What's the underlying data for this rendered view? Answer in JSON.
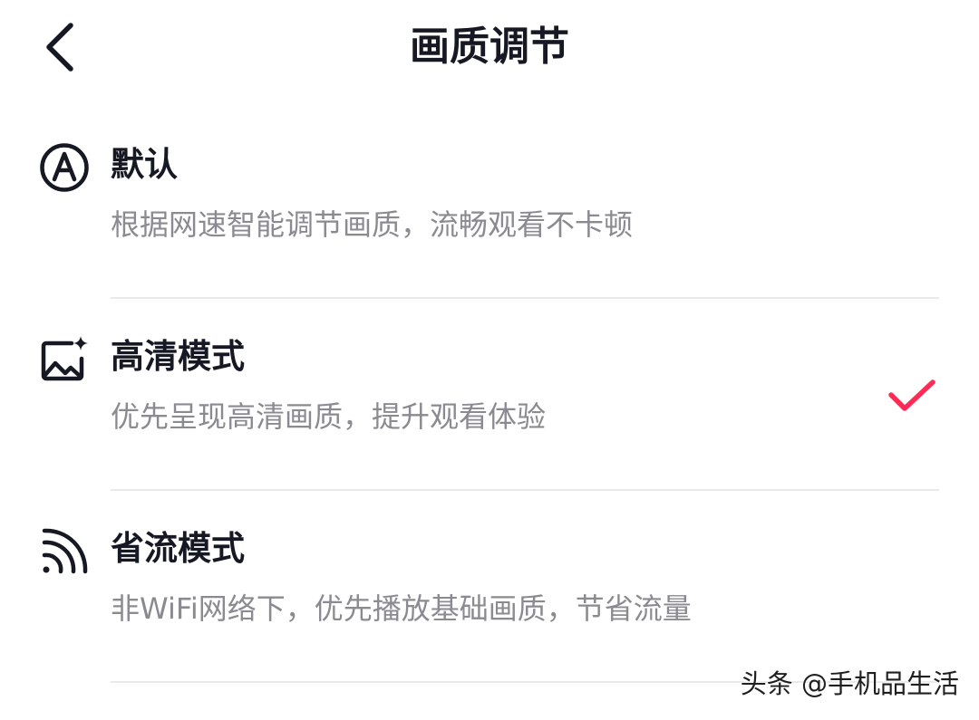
{
  "header": {
    "title": "画质调节"
  },
  "options": [
    {
      "title": "默认",
      "description": "根据网速智能调节画质，流畅观看不卡顿",
      "icon": "auto-a-circle-icon",
      "selected": false
    },
    {
      "title": "高清模式",
      "description": "优先呈现高清画质，提升观看体验",
      "icon": "hd-image-sparkle-icon",
      "selected": true
    },
    {
      "title": "省流模式",
      "description": "非WiFi网络下，优先播放基础画质，节省流量",
      "icon": "signal-arcs-icon",
      "selected": false
    }
  ],
  "colors": {
    "check": "#fe2c55",
    "text_primary": "#161823",
    "text_secondary": "#8a8b91",
    "divider": "#e9e9eb"
  },
  "watermark": {
    "text": "头条 @手机品生活"
  }
}
